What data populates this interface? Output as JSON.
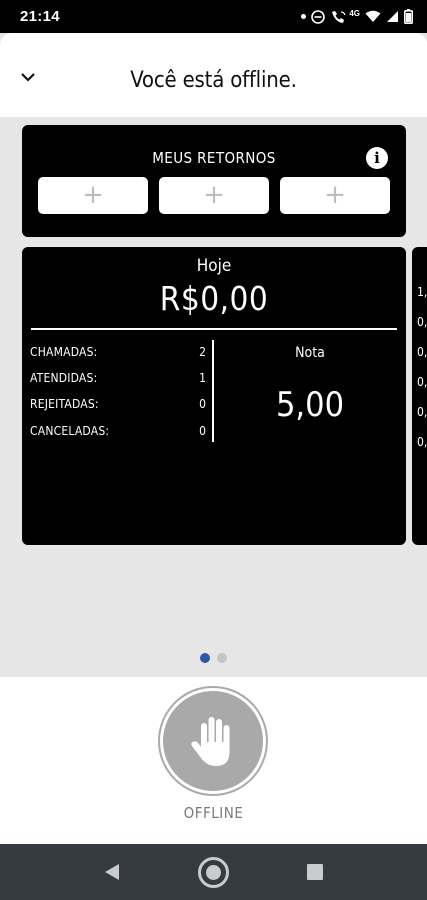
{
  "status_bar": {
    "time": "21:14",
    "icons": [
      "notification-dot",
      "do-not-disturb-icon",
      "wifi-call-icon",
      "network-4g-icon",
      "wifi-icon",
      "signal-icon",
      "battery-icon"
    ],
    "network_label": "4G"
  },
  "header": {
    "title": "Você está offline.",
    "collapse_icon": "chevron-down-icon"
  },
  "returns": {
    "title": "MEUS RETORNOS",
    "info_icon": "info-icon",
    "slots": [
      "+",
      "+",
      "+"
    ]
  },
  "summary": {
    "period": "Hoje",
    "earnings": "R$0,00",
    "stats": [
      {
        "label": "CHAMADAS:",
        "value": "2"
      },
      {
        "label": "ATENDIDAS:",
        "value": "1"
      },
      {
        "label": "REJEITADAS:",
        "value": "0"
      },
      {
        "label": "CANCELADAS:",
        "value": "0"
      }
    ],
    "rating_label": "Nota",
    "rating_value": "5,00"
  },
  "next_card_peek": [
    "1,",
    "0,",
    "0,",
    "0,",
    "0,",
    "0,"
  ],
  "pager": {
    "count": 2,
    "active": 0
  },
  "status_button": {
    "label": "OFFLINE",
    "icon": "hand-stop-icon"
  },
  "nav": {
    "back": "back-icon",
    "home": "home-icon",
    "recents": "recents-icon"
  },
  "colors": {
    "background": "#e6e6e6",
    "card": "#000000",
    "active_dot": "#2d57a8",
    "toggle": "#a9a9a9",
    "navbar": "#363b42"
  }
}
